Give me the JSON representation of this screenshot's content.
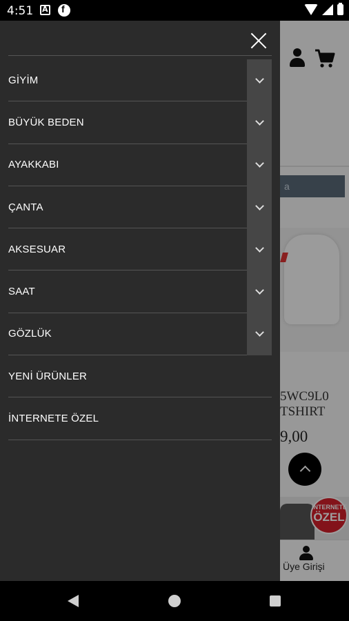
{
  "status_bar": {
    "time": "4:51"
  },
  "drawer": {
    "items": [
      {
        "label": "GİYİM",
        "expandable": true
      },
      {
        "label": "BÜYÜK BEDEN",
        "expandable": true
      },
      {
        "label": "AYAKKABI",
        "expandable": true
      },
      {
        "label": "ÇANTA",
        "expandable": true
      },
      {
        "label": "AKSESUAR",
        "expandable": true
      },
      {
        "label": "SAAT",
        "expandable": true
      },
      {
        "label": "GÖZLÜK",
        "expandable": true
      },
      {
        "label": "YENİ ÜRÜNLER",
        "expandable": false
      },
      {
        "label": "İNTERNETE ÖZEL",
        "expandable": false
      }
    ]
  },
  "background": {
    "search_fragment": "a",
    "product_code_fragment": "5WC9L0",
    "product_type_fragment": "TSHIRT",
    "price_fragment": "9,00",
    "badge_line1": "İNTERNETE",
    "badge_line2": "ÖZEL",
    "bottom_nav_label": "Üye Girişi"
  },
  "colors": {
    "drawer_bg": "#2b2b2b",
    "expand_button_bg": "#464646",
    "divider": "#555555",
    "badge_red": "#d4202a"
  }
}
